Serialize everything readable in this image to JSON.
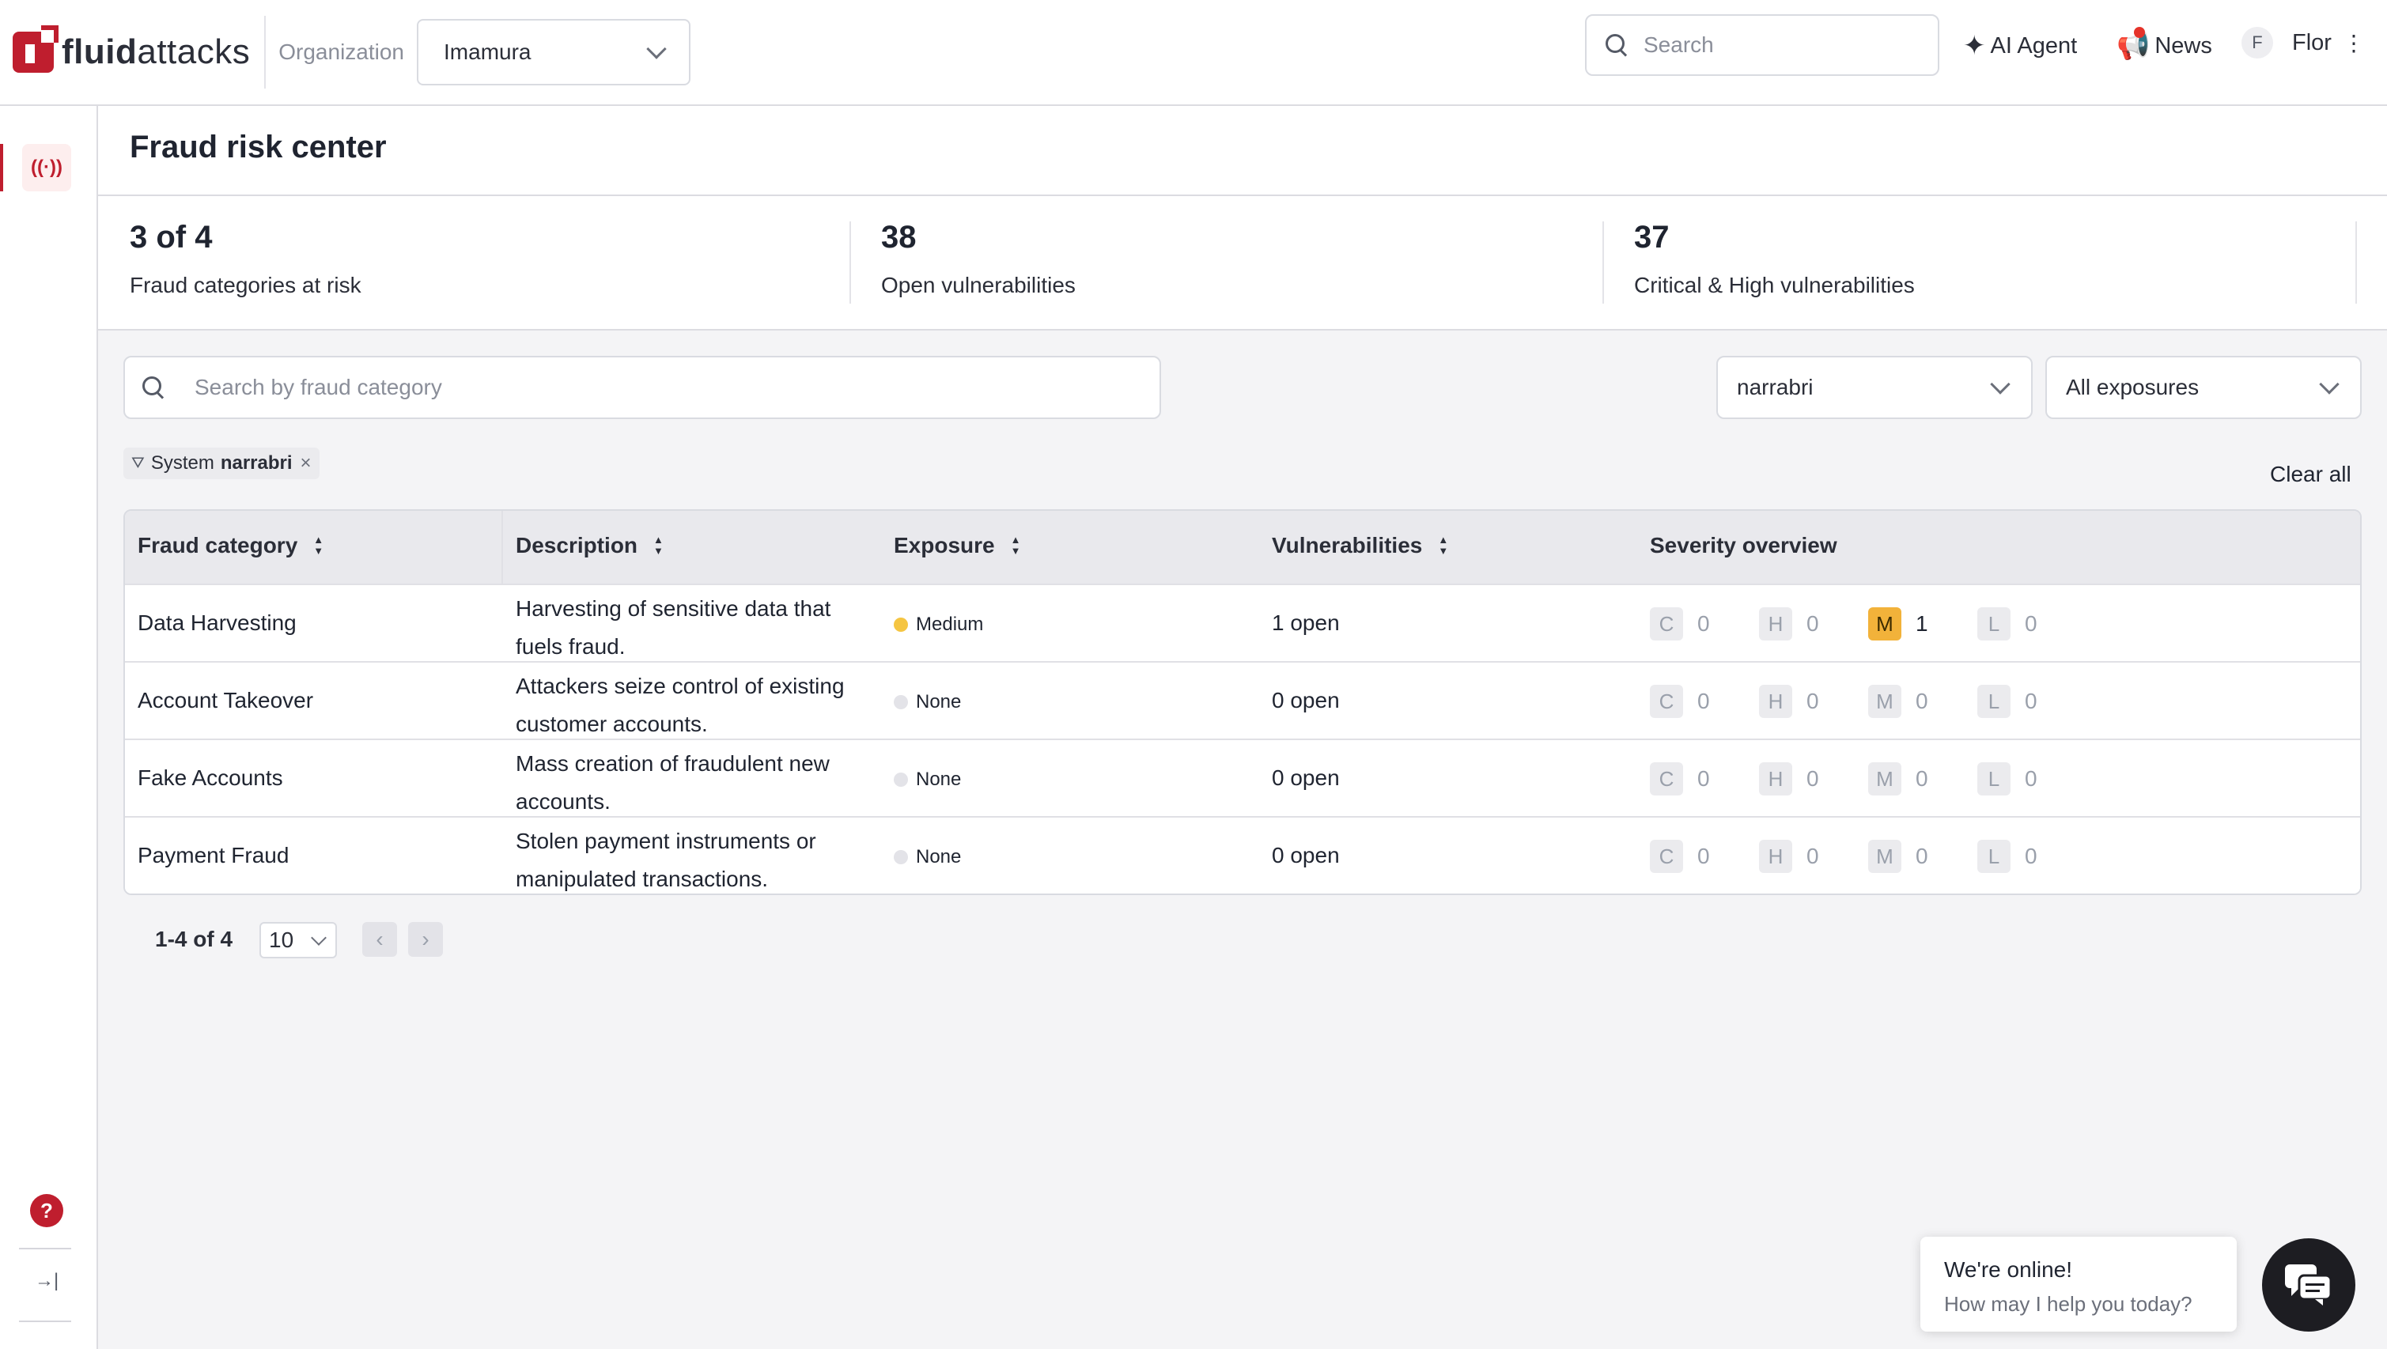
{
  "brand": {
    "logo_bold": "fluid",
    "logo_regular": "attacks"
  },
  "topbar": {
    "org_label": "Organization",
    "org_value": "Imamura",
    "search_placeholder": "Search",
    "ai_agent": "AI Agent",
    "news": "News",
    "user_initial": "F",
    "user_name": "Flor"
  },
  "rail": {
    "active_icon": "fraud-radar-icon",
    "active_glyph": "((·))",
    "help_glyph": "?",
    "collapse_glyph": "→|"
  },
  "page": {
    "title": "Fraud risk center"
  },
  "stats": [
    {
      "value": "3 of 4",
      "label": "Fraud categories at risk"
    },
    {
      "value": "38",
      "label": "Open vulnerabilities"
    },
    {
      "value": "37",
      "label": "Critical & High vulnerabilities"
    }
  ],
  "filters": {
    "search_placeholder": "Search by fraud category",
    "system_value": "narrabri",
    "exposure_value": "All exposures",
    "chip_label": "System",
    "chip_value": "narrabri",
    "clear_all": "Clear all"
  },
  "table": {
    "columns": [
      "Fraud category",
      "Description",
      "Exposure",
      "Vulnerabilities",
      "Severity overview"
    ],
    "rows": [
      {
        "category": "Data Harvesting",
        "description": "Harvesting of sensitive data that fuels fraud.",
        "exposure": "Medium",
        "vulnerabilities": "1 open",
        "severity": [
          "0",
          "0",
          "1",
          "0"
        ]
      },
      {
        "category": "Account Takeover",
        "description": "Attackers seize control of existing customer accounts.",
        "exposure": "None",
        "vulnerabilities": "0 open",
        "severity": [
          "0",
          "0",
          "0",
          "0"
        ]
      },
      {
        "category": "Fake Accounts",
        "description": "Mass creation of fraudulent new accounts.",
        "exposure": "None",
        "vulnerabilities": "0 open",
        "severity": [
          "0",
          "0",
          "0",
          "0"
        ]
      },
      {
        "category": "Payment Fraud",
        "description": "Stolen payment instruments or manipulated transactions.",
        "exposure": "None",
        "vulnerabilities": "0 open",
        "severity": [
          "0",
          "0",
          "0",
          "0"
        ]
      }
    ],
    "severity_letters": [
      "C",
      "H",
      "M",
      "L"
    ]
  },
  "pagination": {
    "range": "1-4 of 4",
    "page_size": "10",
    "prev": "‹",
    "next": "›"
  },
  "chat": {
    "title": "We're online!",
    "subtitle": "How may I help you today?"
  },
  "colors": {
    "brand": "#bf1e2e",
    "medium": "#f2b23a",
    "exposure_medium_dot": "#f5c542",
    "exposure_none_dot": "#e3e3e8"
  }
}
